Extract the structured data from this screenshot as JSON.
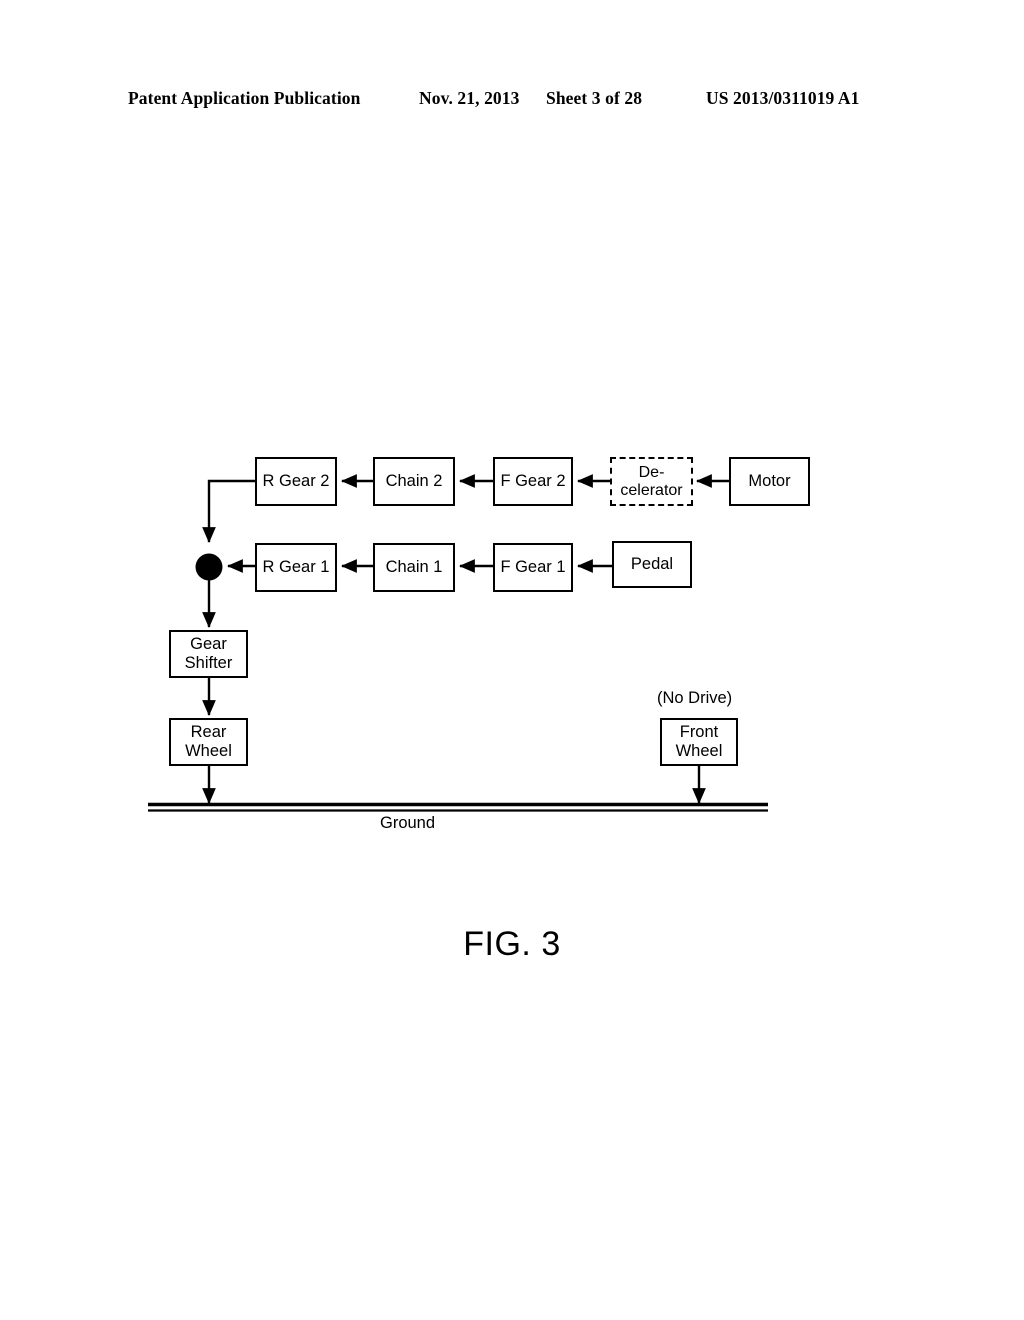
{
  "header": {
    "publication": "Patent Application Publication",
    "date": "Nov. 21, 2013",
    "sheet": "Sheet 3 of 28",
    "number": "US 2013/0311019 A1"
  },
  "figure": {
    "caption": "FIG. 3",
    "ground_label": "Ground",
    "no_drive_label": "(No Drive)",
    "blocks": {
      "r_gear_2": "R Gear 2",
      "chain_2": "Chain 2",
      "f_gear_2": "F Gear 2",
      "decelerator_line1": "De-",
      "decelerator_line2": "celerator",
      "motor": "Motor",
      "r_gear_1": "R Gear 1",
      "chain_1": "Chain 1",
      "f_gear_1": "F Gear 1",
      "pedal": "Pedal",
      "gear_shifter_line1": "Gear",
      "gear_shifter_line2": "Shifter",
      "rear_wheel_line1": "Rear",
      "rear_wheel_line2": "Wheel",
      "front_wheel_line1": "Front",
      "front_wheel_line2": "Wheel"
    }
  },
  "colors": {
    "ink": "#000000",
    "paper": "#ffffff"
  }
}
